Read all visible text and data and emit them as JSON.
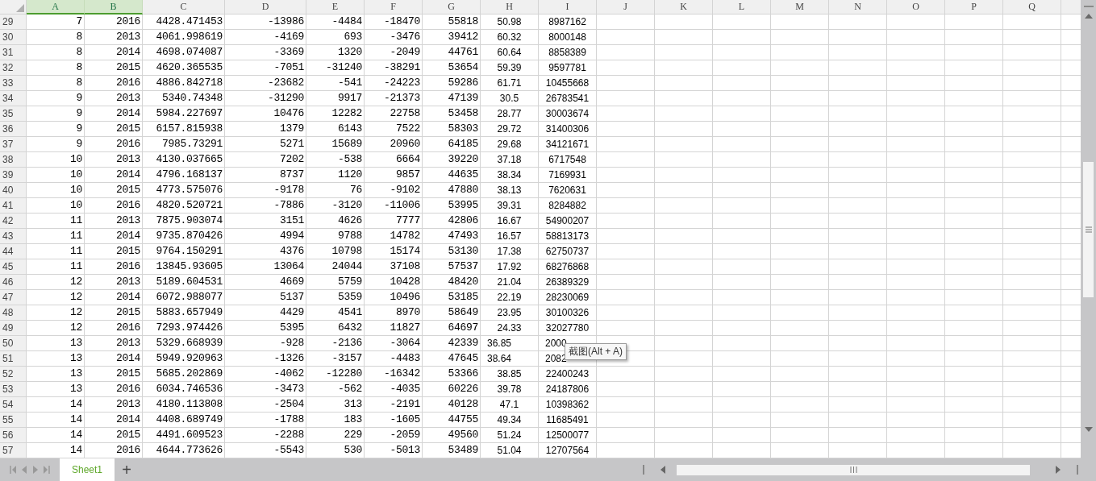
{
  "columns": [
    {
      "label": "A",
      "selected": true
    },
    {
      "label": "B",
      "selected": true
    },
    {
      "label": "C",
      "selected": false
    },
    {
      "label": "D",
      "selected": false
    },
    {
      "label": "E",
      "selected": false
    },
    {
      "label": "F",
      "selected": false
    },
    {
      "label": "G",
      "selected": false
    },
    {
      "label": "H",
      "selected": false
    },
    {
      "label": "I",
      "selected": false
    },
    {
      "label": "J",
      "selected": false
    },
    {
      "label": "K",
      "selected": false
    },
    {
      "label": "L",
      "selected": false
    },
    {
      "label": "M",
      "selected": false
    },
    {
      "label": "N",
      "selected": false
    },
    {
      "label": "O",
      "selected": false
    },
    {
      "label": "P",
      "selected": false
    },
    {
      "label": "Q",
      "selected": false
    }
  ],
  "rows": [
    {
      "number": "29",
      "cells": [
        "7",
        "2016",
        "4428.471453",
        "-13986",
        "-4484",
        "-18470",
        "55818",
        "50.98",
        "8987162"
      ]
    },
    {
      "number": "30",
      "cells": [
        "8",
        "2013",
        "4061.998619",
        "-4169",
        "693",
        "-3476",
        "39412",
        "60.32",
        "8000148"
      ]
    },
    {
      "number": "31",
      "cells": [
        "8",
        "2014",
        "4698.074087",
        "-3369",
        "1320",
        "-2049",
        "44761",
        "60.64",
        "8858389"
      ]
    },
    {
      "number": "32",
      "cells": [
        "8",
        "2015",
        "4620.365535",
        "-7051",
        "-31240",
        "-38291",
        "53654",
        "59.39",
        "9597781"
      ]
    },
    {
      "number": "33",
      "cells": [
        "8",
        "2016",
        "4886.842718",
        "-23682",
        "-541",
        "-24223",
        "59286",
        "61.71",
        "10455668"
      ]
    },
    {
      "number": "34",
      "cells": [
        "9",
        "2013",
        "5340.74348",
        "-31290",
        "9917",
        "-21373",
        "47139",
        "30.5",
        "26783541"
      ]
    },
    {
      "number": "35",
      "cells": [
        "9",
        "2014",
        "5984.227697",
        "10476",
        "12282",
        "22758",
        "53458",
        "28.77",
        "30003674"
      ]
    },
    {
      "number": "36",
      "cells": [
        "9",
        "2015",
        "6157.815938",
        "1379",
        "6143",
        "7522",
        "58303",
        "29.72",
        "31400306"
      ]
    },
    {
      "number": "37",
      "cells": [
        "9",
        "2016",
        "7985.73291",
        "5271",
        "15689",
        "20960",
        "64185",
        "29.68",
        "34121671"
      ]
    },
    {
      "number": "38",
      "cells": [
        "10",
        "2013",
        "4130.037665",
        "7202",
        "-538",
        "6664",
        "39220",
        "37.18",
        "6717548"
      ]
    },
    {
      "number": "39",
      "cells": [
        "10",
        "2014",
        "4796.168137",
        "8737",
        "1120",
        "9857",
        "44635",
        "38.34",
        "7169931"
      ]
    },
    {
      "number": "40",
      "cells": [
        "10",
        "2015",
        "4773.575076",
        "-9178",
        "76",
        "-9102",
        "47880",
        "38.13",
        "7620631"
      ]
    },
    {
      "number": "41",
      "cells": [
        "10",
        "2016",
        "4820.520721",
        "-7886",
        "-3120",
        "-11006",
        "53995",
        "39.31",
        "8284882"
      ]
    },
    {
      "number": "42",
      "cells": [
        "11",
        "2013",
        "7875.903074",
        "3151",
        "4626",
        "7777",
        "42806",
        "16.67",
        "54900207"
      ]
    },
    {
      "number": "43",
      "cells": [
        "11",
        "2014",
        "9735.870426",
        "4994",
        "9788",
        "14782",
        "47493",
        "16.57",
        "58813173"
      ]
    },
    {
      "number": "44",
      "cells": [
        "11",
        "2015",
        "9764.150291",
        "4376",
        "10798",
        "15174",
        "53130",
        "17.38",
        "62750737"
      ]
    },
    {
      "number": "45",
      "cells": [
        "11",
        "2016",
        "13845.93605",
        "13064",
        "24044",
        "37108",
        "57537",
        "17.92",
        "68276868"
      ]
    },
    {
      "number": "46",
      "cells": [
        "12",
        "2013",
        "5189.604531",
        "4669",
        "5759",
        "10428",
        "48420",
        "21.04",
        "26389329"
      ]
    },
    {
      "number": "47",
      "cells": [
        "12",
        "2014",
        "6072.988077",
        "5137",
        "5359",
        "10496",
        "53185",
        "22.19",
        "28230069"
      ]
    },
    {
      "number": "48",
      "cells": [
        "12",
        "2015",
        "5883.657949",
        "4429",
        "4541",
        "8970",
        "58649",
        "23.95",
        "30100326"
      ]
    },
    {
      "number": "49",
      "cells": [
        "12",
        "2016",
        "7293.974426",
        "5395",
        "6432",
        "11827",
        "64697",
        "24.33",
        "32027780"
      ]
    },
    {
      "number": "50",
      "cells": [
        "13",
        "2013",
        "5329.668939",
        "-928",
        "-2136",
        "-3064",
        "42339",
        "36.85",
        "2000"
      ],
      "covered": true
    },
    {
      "number": "51",
      "cells": [
        "13",
        "2014",
        "5949.920963",
        "-1326",
        "-3157",
        "-4483",
        "47645",
        "38.64",
        "2082"
      ],
      "covered": true
    },
    {
      "number": "52",
      "cells": [
        "13",
        "2015",
        "5685.202869",
        "-4062",
        "-12280",
        "-16342",
        "53366",
        "38.85",
        "22400243"
      ]
    },
    {
      "number": "53",
      "cells": [
        "13",
        "2016",
        "6034.746536",
        "-3473",
        "-562",
        "-4035",
        "60226",
        "39.78",
        "24187806"
      ]
    },
    {
      "number": "54",
      "cells": [
        "14",
        "2013",
        "4180.113808",
        "-2504",
        "313",
        "-2191",
        "40128",
        "47.1",
        "10398362"
      ]
    },
    {
      "number": "55",
      "cells": [
        "14",
        "2014",
        "4408.689749",
        "-1788",
        "183",
        "-1605",
        "44755",
        "49.34",
        "11685491"
      ]
    },
    {
      "number": "56",
      "cells": [
        "14",
        "2015",
        "4491.609523",
        "-2288",
        "229",
        "-2059",
        "49560",
        "51.24",
        "12500077"
      ]
    },
    {
      "number": "57",
      "cells": [
        "14",
        "2016",
        "4644.773626",
        "-5543",
        "530",
        "-5013",
        "53489",
        "51.04",
        "12707564"
      ]
    }
  ],
  "tooltip": "截图(Alt + A)",
  "sheets": [
    {
      "label": "Sheet1",
      "selected": true
    }
  ],
  "add_sheet": "+"
}
